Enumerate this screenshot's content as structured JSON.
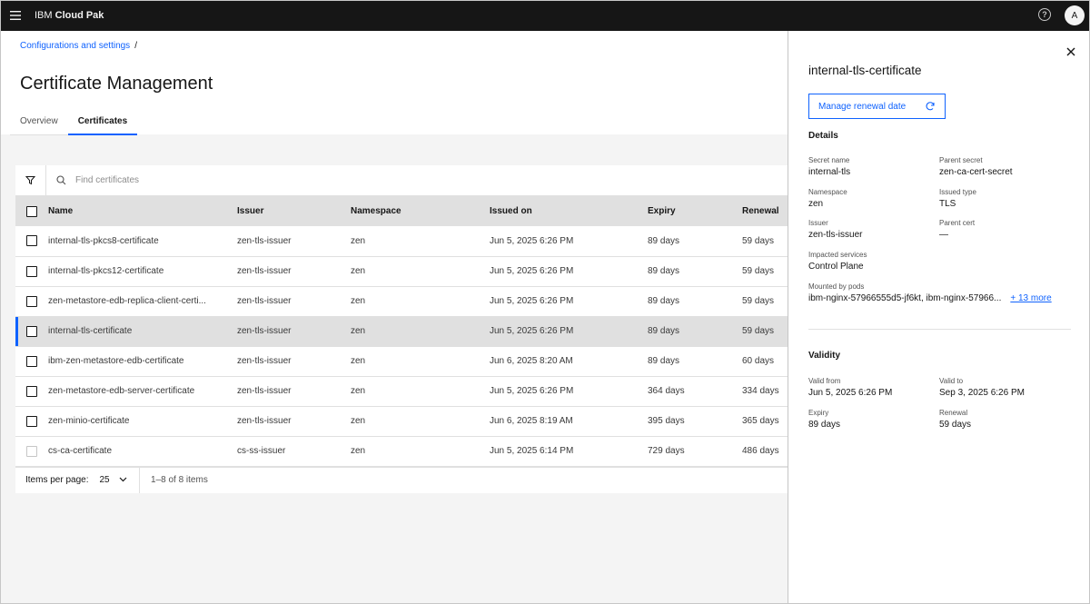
{
  "header": {
    "brand_prefix": "IBM",
    "brand_name": "Cloud Pak",
    "help_glyph": "?",
    "avatar_initial": "A"
  },
  "breadcrumb": {
    "item": "Configurations and settings",
    "separator": "/"
  },
  "page_title": "Certificate Management",
  "tabs": [
    {
      "label": "Overview",
      "active": false
    },
    {
      "label": "Certificates",
      "active": true
    }
  ],
  "search": {
    "placeholder": "Find certificates"
  },
  "table": {
    "columns": [
      "Name",
      "Issuer",
      "Namespace",
      "Issued on",
      "Expiry",
      "Renewal"
    ],
    "rows": [
      {
        "name": "internal-tls-pkcs8-certificate",
        "issuer": "zen-tls-issuer",
        "namespace": "zen",
        "issued_on": "Jun 5, 2025 6:26 PM",
        "expiry": "89 days",
        "renewal": "59 days"
      },
      {
        "name": "internal-tls-pkcs12-certificate",
        "issuer": "zen-tls-issuer",
        "namespace": "zen",
        "issued_on": "Jun 5, 2025 6:26 PM",
        "expiry": "89 days",
        "renewal": "59 days"
      },
      {
        "name": "zen-metastore-edb-replica-client-certi...",
        "issuer": "zen-tls-issuer",
        "namespace": "zen",
        "issued_on": "Jun 5, 2025 6:26 PM",
        "expiry": "89 days",
        "renewal": "59 days"
      },
      {
        "name": "internal-tls-certificate",
        "issuer": "zen-tls-issuer",
        "namespace": "zen",
        "issued_on": "Jun 5, 2025 6:26 PM",
        "expiry": "89 days",
        "renewal": "59 days"
      },
      {
        "name": "ibm-zen-metastore-edb-certificate",
        "issuer": "zen-tls-issuer",
        "namespace": "zen",
        "issued_on": "Jun 6, 2025 8:20 AM",
        "expiry": "89 days",
        "renewal": "60 days"
      },
      {
        "name": "zen-metastore-edb-server-certificate",
        "issuer": "zen-tls-issuer",
        "namespace": "zen",
        "issued_on": "Jun 5, 2025 6:26 PM",
        "expiry": "364 days",
        "renewal": "334 days"
      },
      {
        "name": "zen-minio-certificate",
        "issuer": "zen-tls-issuer",
        "namespace": "zen",
        "issued_on": "Jun 6, 2025 8:19 AM",
        "expiry": "395 days",
        "renewal": "365 days"
      },
      {
        "name": "cs-ca-certificate",
        "issuer": "cs-ss-issuer",
        "namespace": "zen",
        "issued_on": "Jun 5, 2025 6:14 PM",
        "expiry": "729 days",
        "renewal": "486 days"
      }
    ]
  },
  "pagination": {
    "items_per_page_label": "Items per page:",
    "items_per_page_value": "25",
    "range_text": "1–8 of 8 items"
  },
  "panel": {
    "title": "internal-tls-certificate",
    "manage_button": "Manage renewal date",
    "details_title": "Details",
    "secret_name_label": "Secret name",
    "secret_name": "internal-tls",
    "parent_secret_label": "Parent secret",
    "parent_secret": "zen-ca-cert-secret",
    "namespace_label": "Namespace",
    "namespace": "zen",
    "issued_type_label": "Issued type",
    "issued_type": "TLS",
    "issuer_label": "Issuer",
    "issuer": "zen-tls-issuer",
    "parent_cert_label": "Parent cert",
    "parent_cert": "—",
    "impacted_label": "Impacted services",
    "impacted": "Control Plane",
    "mounted_label": "Mounted by pods",
    "mounted": "ibm-nginx-57966555d5-jf6kt, ibm-nginx-57966...",
    "more_link": "+ 13 more",
    "validity_title": "Validity",
    "valid_from_label": "Valid from",
    "valid_from": "Jun 5, 2025 6:26 PM",
    "valid_to_label": "Valid to",
    "valid_to": "Sep 3, 2025 6:26 PM",
    "expiry_label": "Expiry",
    "expiry": "89 days",
    "renewal_label": "Renewal",
    "renewal": "59 days"
  },
  "colors": {
    "accent": "#0f62fe",
    "header_bg": "#161616"
  }
}
